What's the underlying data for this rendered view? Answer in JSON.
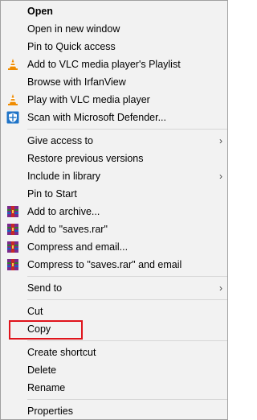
{
  "menu": {
    "group1": [
      {
        "label": "Open",
        "bold": true,
        "icon": ""
      },
      {
        "label": "Open in new window",
        "icon": ""
      },
      {
        "label": "Pin to Quick access",
        "icon": ""
      },
      {
        "label": "Add to VLC media player's Playlist",
        "icon": "vlc-cone-icon"
      },
      {
        "label": "Browse with IrfanView",
        "icon": ""
      },
      {
        "label": "Play with VLC media player",
        "icon": "vlc-cone-icon"
      },
      {
        "label": "Scan with Microsoft Defender...",
        "icon": "defender-shield-icon"
      }
    ],
    "group2": [
      {
        "label": "Give access to",
        "submenu": true
      },
      {
        "label": "Restore previous versions"
      },
      {
        "label": "Include in library",
        "submenu": true
      },
      {
        "label": "Pin to Start"
      },
      {
        "label": "Add to archive...",
        "icon": "winrar-icon"
      },
      {
        "label": "Add to \"saves.rar\"",
        "icon": "winrar-icon"
      },
      {
        "label": "Compress and email...",
        "icon": "winrar-icon"
      },
      {
        "label": "Compress to \"saves.rar\" and email",
        "icon": "winrar-icon"
      }
    ],
    "group3": [
      {
        "label": "Send to",
        "submenu": true
      }
    ],
    "group4": [
      {
        "label": "Cut"
      },
      {
        "label": "Copy",
        "highlighted": true
      }
    ],
    "group5": [
      {
        "label": "Create shortcut"
      },
      {
        "label": "Delete"
      },
      {
        "label": "Rename"
      }
    ],
    "group6": [
      {
        "label": "Properties"
      }
    ],
    "submenu_arrow": "›",
    "highlight_color": "#e0141c"
  }
}
